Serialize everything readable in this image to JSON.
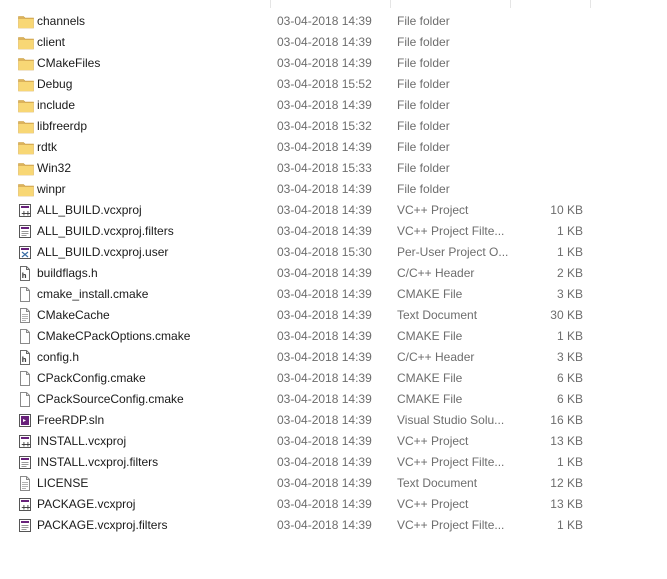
{
  "files": [
    {
      "name": "channels",
      "date": "03-04-2018 14:39",
      "type": "File folder",
      "size": "",
      "icon": "folder-icon"
    },
    {
      "name": "client",
      "date": "03-04-2018 14:39",
      "type": "File folder",
      "size": "",
      "icon": "folder-icon"
    },
    {
      "name": "CMakeFiles",
      "date": "03-04-2018 14:39",
      "type": "File folder",
      "size": "",
      "icon": "folder-icon"
    },
    {
      "name": "Debug",
      "date": "03-04-2018 15:52",
      "type": "File folder",
      "size": "",
      "icon": "folder-icon"
    },
    {
      "name": "include",
      "date": "03-04-2018 14:39",
      "type": "File folder",
      "size": "",
      "icon": "folder-icon"
    },
    {
      "name": "libfreerdp",
      "date": "03-04-2018 15:32",
      "type": "File folder",
      "size": "",
      "icon": "folder-icon"
    },
    {
      "name": "rdtk",
      "date": "03-04-2018 14:39",
      "type": "File folder",
      "size": "",
      "icon": "folder-icon"
    },
    {
      "name": "Win32",
      "date": "03-04-2018 15:33",
      "type": "File folder",
      "size": "",
      "icon": "folder-icon"
    },
    {
      "name": "winpr",
      "date": "03-04-2018 14:39",
      "type": "File folder",
      "size": "",
      "icon": "folder-icon"
    },
    {
      "name": "ALL_BUILD.vcxproj",
      "date": "03-04-2018 14:39",
      "type": "VC++ Project",
      "size": "10 KB",
      "icon": "vcxproj-icon"
    },
    {
      "name": "ALL_BUILD.vcxproj.filters",
      "date": "03-04-2018 14:39",
      "type": "VC++ Project Filte...",
      "size": "1 KB",
      "icon": "filters-icon"
    },
    {
      "name": "ALL_BUILD.vcxproj.user",
      "date": "03-04-2018 15:30",
      "type": "Per-User Project O...",
      "size": "1 KB",
      "icon": "user-project-icon"
    },
    {
      "name": "buildflags.h",
      "date": "03-04-2018 14:39",
      "type": "C/C++ Header",
      "size": "2 KB",
      "icon": "header-file-icon"
    },
    {
      "name": "cmake_install.cmake",
      "date": "03-04-2018 14:39",
      "type": "CMAKE File",
      "size": "3 KB",
      "icon": "blank-file-icon"
    },
    {
      "name": "CMakeCache",
      "date": "03-04-2018 14:39",
      "type": "Text Document",
      "size": "30 KB",
      "icon": "text-document-icon"
    },
    {
      "name": "CMakeCPackOptions.cmake",
      "date": "03-04-2018 14:39",
      "type": "CMAKE File",
      "size": "1 KB",
      "icon": "blank-file-icon"
    },
    {
      "name": "config.h",
      "date": "03-04-2018 14:39",
      "type": "C/C++ Header",
      "size": "3 KB",
      "icon": "header-file-icon"
    },
    {
      "name": "CPackConfig.cmake",
      "date": "03-04-2018 14:39",
      "type": "CMAKE File",
      "size": "6 KB",
      "icon": "blank-file-icon"
    },
    {
      "name": "CPackSourceConfig.cmake",
      "date": "03-04-2018 14:39",
      "type": "CMAKE File",
      "size": "6 KB",
      "icon": "blank-file-icon"
    },
    {
      "name": "FreeRDP.sln",
      "date": "03-04-2018 14:39",
      "type": "Visual Studio Solu...",
      "size": "16 KB",
      "icon": "solution-icon"
    },
    {
      "name": "INSTALL.vcxproj",
      "date": "03-04-2018 14:39",
      "type": "VC++ Project",
      "size": "13 KB",
      "icon": "vcxproj-icon"
    },
    {
      "name": "INSTALL.vcxproj.filters",
      "date": "03-04-2018 14:39",
      "type": "VC++ Project Filte...",
      "size": "1 KB",
      "icon": "filters-icon"
    },
    {
      "name": "LICENSE",
      "date": "03-04-2018 14:39",
      "type": "Text Document",
      "size": "12 KB",
      "icon": "text-document-icon"
    },
    {
      "name": "PACKAGE.vcxproj",
      "date": "03-04-2018 14:39",
      "type": "VC++ Project",
      "size": "13 KB",
      "icon": "vcxproj-icon"
    },
    {
      "name": "PACKAGE.vcxproj.filters",
      "date": "03-04-2018 14:39",
      "type": "VC++ Project Filte...",
      "size": "1 KB",
      "icon": "filters-icon"
    }
  ]
}
